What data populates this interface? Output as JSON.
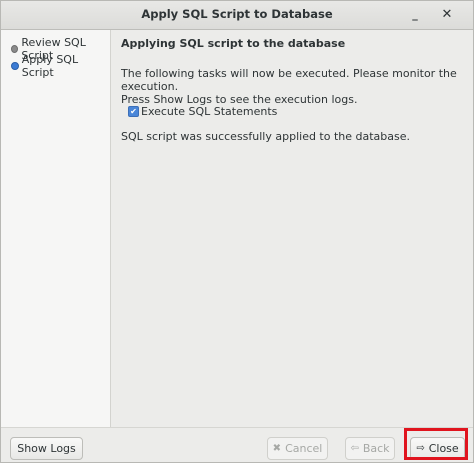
{
  "window": {
    "title": "Apply SQL Script to Database",
    "minimize_glyph": "_",
    "close_glyph": "✕"
  },
  "sidebar": {
    "items": [
      {
        "label": "Review SQL Script",
        "state": "done"
      },
      {
        "label": "Apply SQL Script",
        "state": "current"
      }
    ]
  },
  "content": {
    "heading": "Applying SQL script to the database",
    "description_line1": "The following tasks will now be executed. Please monitor the execution.",
    "description_line2": "Press Show Logs to see the execution logs.",
    "task": {
      "label": "Execute SQL Statements",
      "checked": true,
      "check_glyph": "✔"
    },
    "result": "SQL script was successfully applied to the database."
  },
  "footer": {
    "show_logs": "Show Logs",
    "cancel": "Cancel",
    "back": "Back",
    "close": "Close",
    "cancel_icon_glyph": "✖",
    "back_icon_glyph": "⇦",
    "close_icon_glyph": "⇨"
  },
  "colors": {
    "highlight": "#e0141e",
    "accent": "#3b7bd4"
  }
}
